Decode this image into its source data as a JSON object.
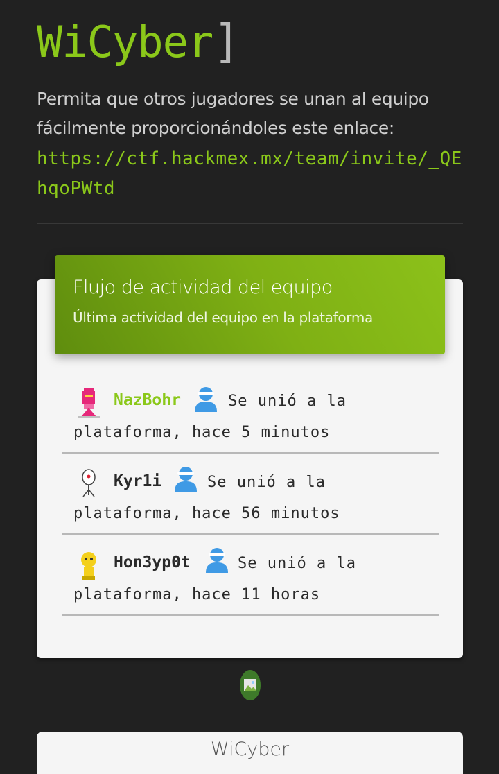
{
  "team": {
    "name": "WiCyber",
    "bracket": "]",
    "invite_text": "Permita que otros jugadores se unan al equipo fácilmente proporcionándoles este enlace:",
    "invite_link": "https://ctf.hackmex.mx/team/invite/_QEhqoPWtd"
  },
  "activity_card": {
    "title": "Flujo de actividad del equipo",
    "subtitle": "Última actividad del equipo en la plataforma",
    "items": [
      {
        "user": "NazBohr",
        "captain": true,
        "action": "Se unió a la",
        "time": "plataforma, hace 5 minutos",
        "avatar": "pink-robot-avatar"
      },
      {
        "user": "Kyr1i",
        "captain": false,
        "action": "Se unió a la",
        "time": "plataforma, hace 56 minutos",
        "avatar": "white-robot-avatar"
      },
      {
        "user": "Hon3yp0t",
        "captain": false,
        "action": "Se unió a la",
        "time": "plataforma, hace 11 horas",
        "avatar": "yellow-robot-avatar"
      }
    ]
  },
  "bottom_card": {
    "title": "WiCyber"
  },
  "colors": {
    "background": "#212121",
    "accent": "#8bc81a",
    "ninja_icon": "#3f9ae5"
  }
}
